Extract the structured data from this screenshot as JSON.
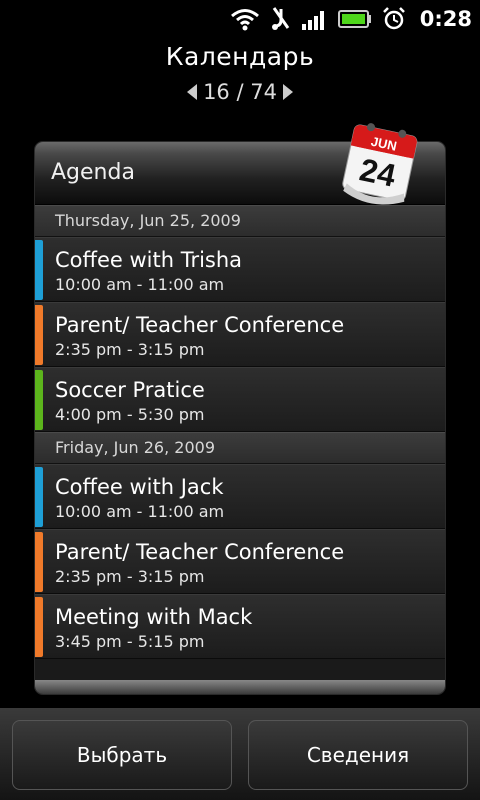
{
  "status_bar": {
    "time": "0:28",
    "icons": [
      "wifi-icon",
      "usb-debug-icon",
      "signal-icon",
      "battery-icon",
      "alarm-icon"
    ]
  },
  "header": {
    "title": "Календарь",
    "pager": "16 / 74"
  },
  "widget": {
    "title": "Agenda",
    "calendar_icon": {
      "month": "JUN",
      "day": "24"
    },
    "days": [
      {
        "date": "Thursday, Jun 25, 2009",
        "events": [
          {
            "title": "Coffee with Trisha",
            "time": "10:00 am - 11:00 am",
            "color": "#1e9fd6"
          },
          {
            "title": "Parent/ Teacher Conference",
            "time": "2:35 pm - 3:15 pm",
            "color": "#f07a2a"
          },
          {
            "title": "Soccer Pratice",
            "time": "4:00 pm - 5:30 pm",
            "color": "#5cb51c"
          }
        ]
      },
      {
        "date": "Friday, Jun 26, 2009",
        "events": [
          {
            "title": "Coffee with Jack",
            "time": "10:00 am - 11:00 am",
            "color": "#1e9fd6"
          },
          {
            "title": "Parent/ Teacher Conference",
            "time": "2:35 pm - 3:15 pm",
            "color": "#f07a2a"
          },
          {
            "title": "Meeting with Mack",
            "time": "3:45 pm - 5:15 pm",
            "color": "#f07a2a"
          }
        ]
      }
    ]
  },
  "buttons": {
    "select": "Выбрать",
    "details": "Сведения"
  }
}
